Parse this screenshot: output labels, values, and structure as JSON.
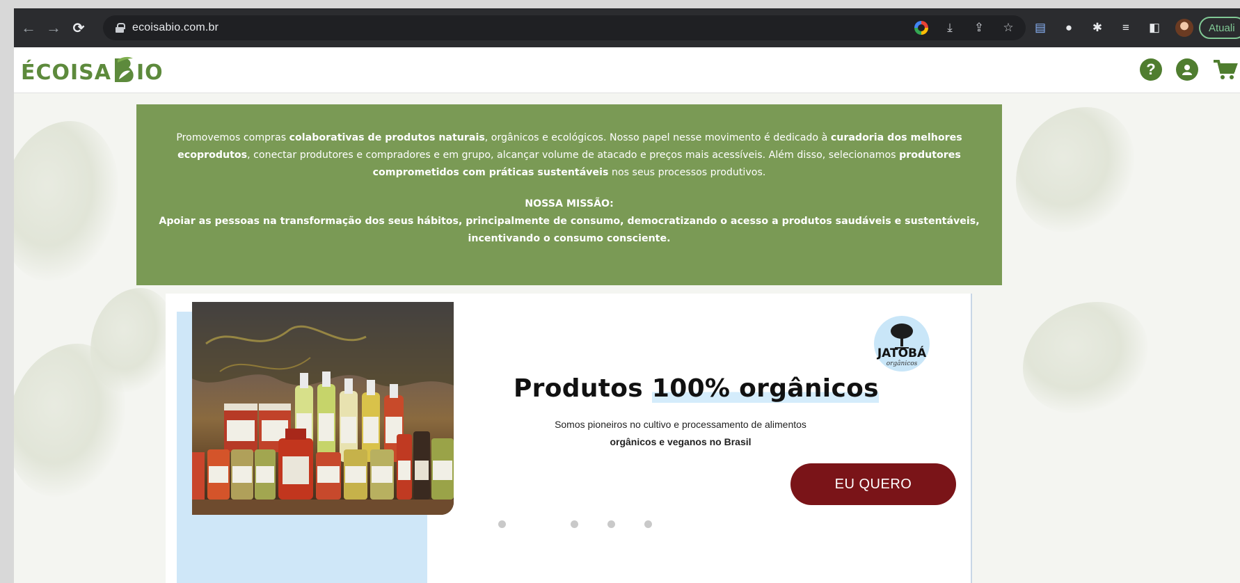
{
  "browser": {
    "url": "ecoisabio.com.br",
    "update_label": "Atuali"
  },
  "site": {
    "logo_left": "ÉCOISA",
    "logo_right": "IO"
  },
  "mission": {
    "p1_a": "Promovemos compras ",
    "p1_b": "colaborativas de produtos naturais",
    "p1_c": ", orgânicos e ecológicos. Nosso papel nesse movimento é dedicado à ",
    "p1_d": "curadoria dos melhores ecoprodutos",
    "p1_e": ", conectar produtores e compradores e em grupo, alcançar volume de atacado e preços mais acessíveis. Além disso, selecionamos ",
    "p1_f": "produtores comprometidos com práticas sustentáveis",
    "p1_g": " nos seus processos produtivos.",
    "title": "NOSSA MISSÃO:",
    "text": "Apoiar as pessoas na transformação dos seus hábitos, principalmente de consumo, democratizando o acesso a produtos saudáveis e sustentáveis, incentivando o consumo consciente."
  },
  "promo": {
    "brand": "JATOBÁ",
    "brand_sub": "orgânicos",
    "title_a": "Produtos ",
    "title_b": "100% orgânicos",
    "sub_a": "Somos pioneiros no cultivo e processamento de alimentos ",
    "sub_b": "orgânicos e veganos no Brasil",
    "cta": "EU QUERO"
  },
  "icons": {
    "help": "?",
    "accent": "#4f7d2f",
    "banner_color": "#7a9a55",
    "cta_color": "#7a1418"
  }
}
